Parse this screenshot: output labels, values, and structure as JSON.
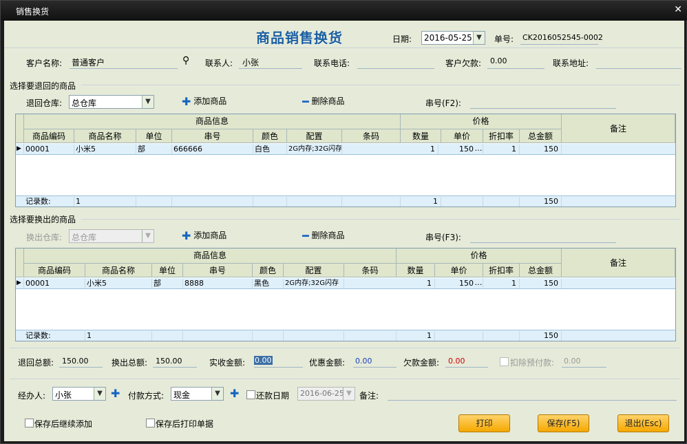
{
  "window": {
    "title": "销售换货",
    "close": "✕"
  },
  "header": {
    "title": "商品销售换货",
    "date_label": "日期:",
    "date_value": "2016-05-25",
    "no_label": "单号:",
    "no_value": "CK2016052545-0002"
  },
  "customer": {
    "name_label": "客户名称:",
    "name_value": "普通客户",
    "contact_label": "联系人:",
    "contact_value": "小张",
    "phone_label": "联系电话:",
    "phone_value": "",
    "debt_label": "客户欠款:",
    "debt_value": "0.00",
    "address_label": "联系地址:",
    "address_value": ""
  },
  "return_section": {
    "title": "选择要退回的商品",
    "warehouse_label": "退回仓库:",
    "warehouse_value": "总仓库",
    "add_label": "添加商品",
    "del_label": "删除商品",
    "serial_label": "串号(F2):",
    "serial_value": ""
  },
  "exchange_section": {
    "title": "选择要换出的商品",
    "warehouse_label": "换出仓库:",
    "warehouse_value": "总仓库",
    "add_label": "添加商品",
    "del_label": "删除商品",
    "serial_label": "串号(F3):",
    "serial_value": ""
  },
  "table_headers": {
    "group_info": "商品信息",
    "group_price": "价格",
    "remark": "备注",
    "code": "商品编码",
    "name": "商品名称",
    "unit": "单位",
    "serial": "串号",
    "color": "颜色",
    "config": "配置",
    "barcode": "条码",
    "qty": "数量",
    "price": "单价",
    "discount": "折扣率",
    "total": "总金额"
  },
  "return_table": {
    "rows": [
      {
        "code": "00001",
        "name": "小米5",
        "unit": "部",
        "serial": "666666",
        "color": "白色",
        "config": "2G内存;32G闪存",
        "barcode": "",
        "qty": "1",
        "price": "150",
        "discount": "1",
        "total": "150"
      }
    ],
    "footer": {
      "label": "记录数:",
      "count": "1",
      "qty": "1",
      "total": "150"
    }
  },
  "exchange_table": {
    "rows": [
      {
        "code": "00001",
        "name": "小米5",
        "unit": "部",
        "serial": "8888",
        "color": "黑色",
        "config": "2G内存;32G闪存",
        "barcode": "",
        "qty": "1",
        "price": "150",
        "discount": "1",
        "total": "150"
      }
    ],
    "footer": {
      "label": "记录数:",
      "count": "1",
      "qty": "1",
      "total": "150"
    }
  },
  "totals": {
    "return_label": "退回总额:",
    "return_value": "150.00",
    "exchange_label": "换出总额:",
    "exchange_value": "150.00",
    "received_label": "实收金额:",
    "received_value": "0.00",
    "discount_label": "优惠金额:",
    "discount_value": "0.00",
    "owed_label": "欠款金额:",
    "owed_value": "0.00",
    "prepay_label": "扣除预付款:",
    "prepay_value": "0.00"
  },
  "payment": {
    "handler_label": "经办人:",
    "handler_value": "小张",
    "method_label": "付款方式:",
    "method_value": "现金",
    "repay_label": "还款日期",
    "repay_value": "2016-06-25",
    "note_label": "备注:",
    "note_value": ""
  },
  "footer": {
    "save_continue": "保存后继续添加",
    "save_print": "保存后打印单据",
    "print": "打印",
    "save": "保存(F5)",
    "exit": "退出(Esc)"
  },
  "colors": {
    "title": "#1a5fa0",
    "owed": "#d00000",
    "discount": "#1a40c0",
    "button": "#f5a800"
  }
}
